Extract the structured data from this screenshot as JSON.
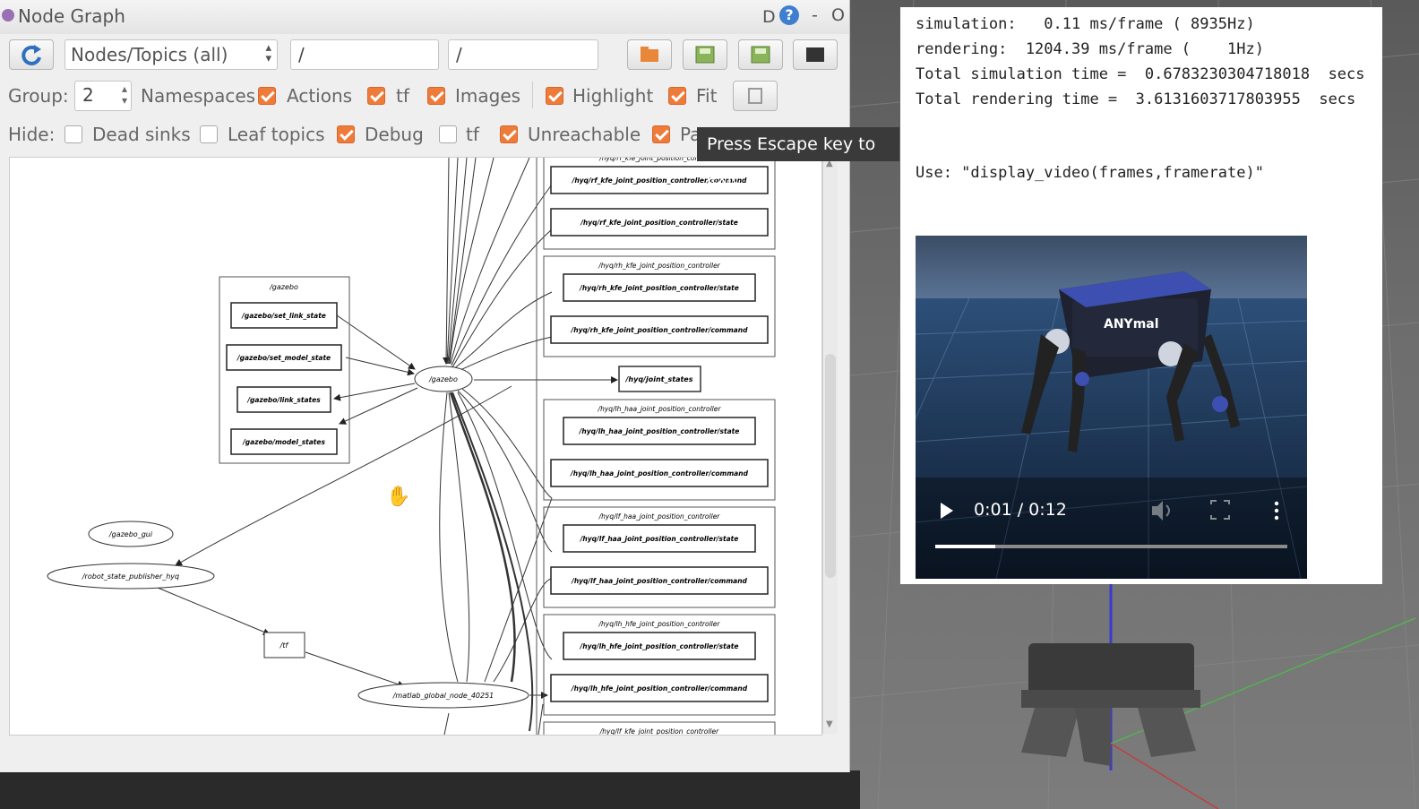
{
  "window": {
    "title": "Node Graph",
    "title_d": "D",
    "help": "?",
    "minimize": "-",
    "close": "O"
  },
  "toolbar": {
    "mode_select": "Nodes/Topics (all)",
    "filter1": "/",
    "filter2": "/"
  },
  "group_row": {
    "group_label": "Group:",
    "group_value": "2",
    "namespaces_label": "Namespaces",
    "actions_label": "Actions",
    "tf_label": "tf",
    "images_label": "Images",
    "highlight_label": "Highlight",
    "fit_label": "Fit",
    "namespaces": true,
    "actions": true,
    "tf": true,
    "images": true,
    "highlight": true,
    "fit": true
  },
  "hide_row": {
    "hide_label": "Hide:",
    "dead_sinks_label": "Dead sinks",
    "leaf_topics_label": "Leaf topics",
    "debug_label": "Debug",
    "tf_label": "tf",
    "unreachable_label": "Unreachable",
    "params_label": "Params",
    "dead_sinks": false,
    "leaf_topics": false,
    "debug": true,
    "tf": false,
    "unreachable": true,
    "params": true
  },
  "tooltip": "Press Escape key to exit",
  "graph": {
    "gazebo_group": "/gazebo",
    "gazebo_topics": [
      "/gazebo/set_link_state",
      "/gazebo/set_model_state",
      "/gazebo/link_states",
      "/gazebo/model_states"
    ],
    "gazebo_node": "/gazebo",
    "gazebo_gui": "/gazebo_gui",
    "robot_state_publisher": "/robot_state_publisher_hyq",
    "tf_topic": "/tf",
    "matlab_node": "/matlab_global_node_40251",
    "joint_states": "/hyq/joint_states",
    "groups": [
      {
        "label": "/hyq/rf_kfe_joint_position_controller",
        "topics": [
          "/hyq/rf_kfe_joint_position_controller/command",
          "/hyq/rf_kfe_joint_position_controller/state"
        ]
      },
      {
        "label": "/hyq/rh_kfe_joint_position_controller",
        "topics": [
          "/hyq/rh_kfe_joint_position_controller/state",
          "/hyq/rh_kfe_joint_position_controller/command"
        ]
      },
      {
        "label": "/hyq/lh_haa_joint_position_controller",
        "topics": [
          "/hyq/lh_haa_joint_position_controller/state",
          "/hyq/lh_haa_joint_position_controller/command"
        ]
      },
      {
        "label": "/hyq/lf_haa_joint_position_controller",
        "topics": [
          "/hyq/lf_haa_joint_position_controller/state",
          "/hyq/lf_haa_joint_position_controller/command"
        ]
      },
      {
        "label": "/hyq/lh_hfe_joint_position_controller",
        "topics": [
          "/hyq/lh_hfe_joint_position_controller/state",
          "/hyq/lh_hfe_joint_position_controller/command"
        ]
      },
      {
        "label": "/hyq/lf_kfe_joint_position_controller",
        "topics": []
      }
    ]
  },
  "colab": {
    "line1": "simulation:   0.11 ms/frame ( 8935Hz)",
    "line2": "rendering:  1204.39 ms/frame (    1Hz)",
    "line3": "Total simulation time =  0.6783230304718018  secs",
    "line4": "Total rendering time =  3.6131603717803955  secs",
    "line5": "Use: \"display_video(frames,framerate)\"",
    "video": {
      "time": "0:01 / 0:12",
      "progress": 0.17,
      "robot_logo": "ANYmal"
    }
  }
}
